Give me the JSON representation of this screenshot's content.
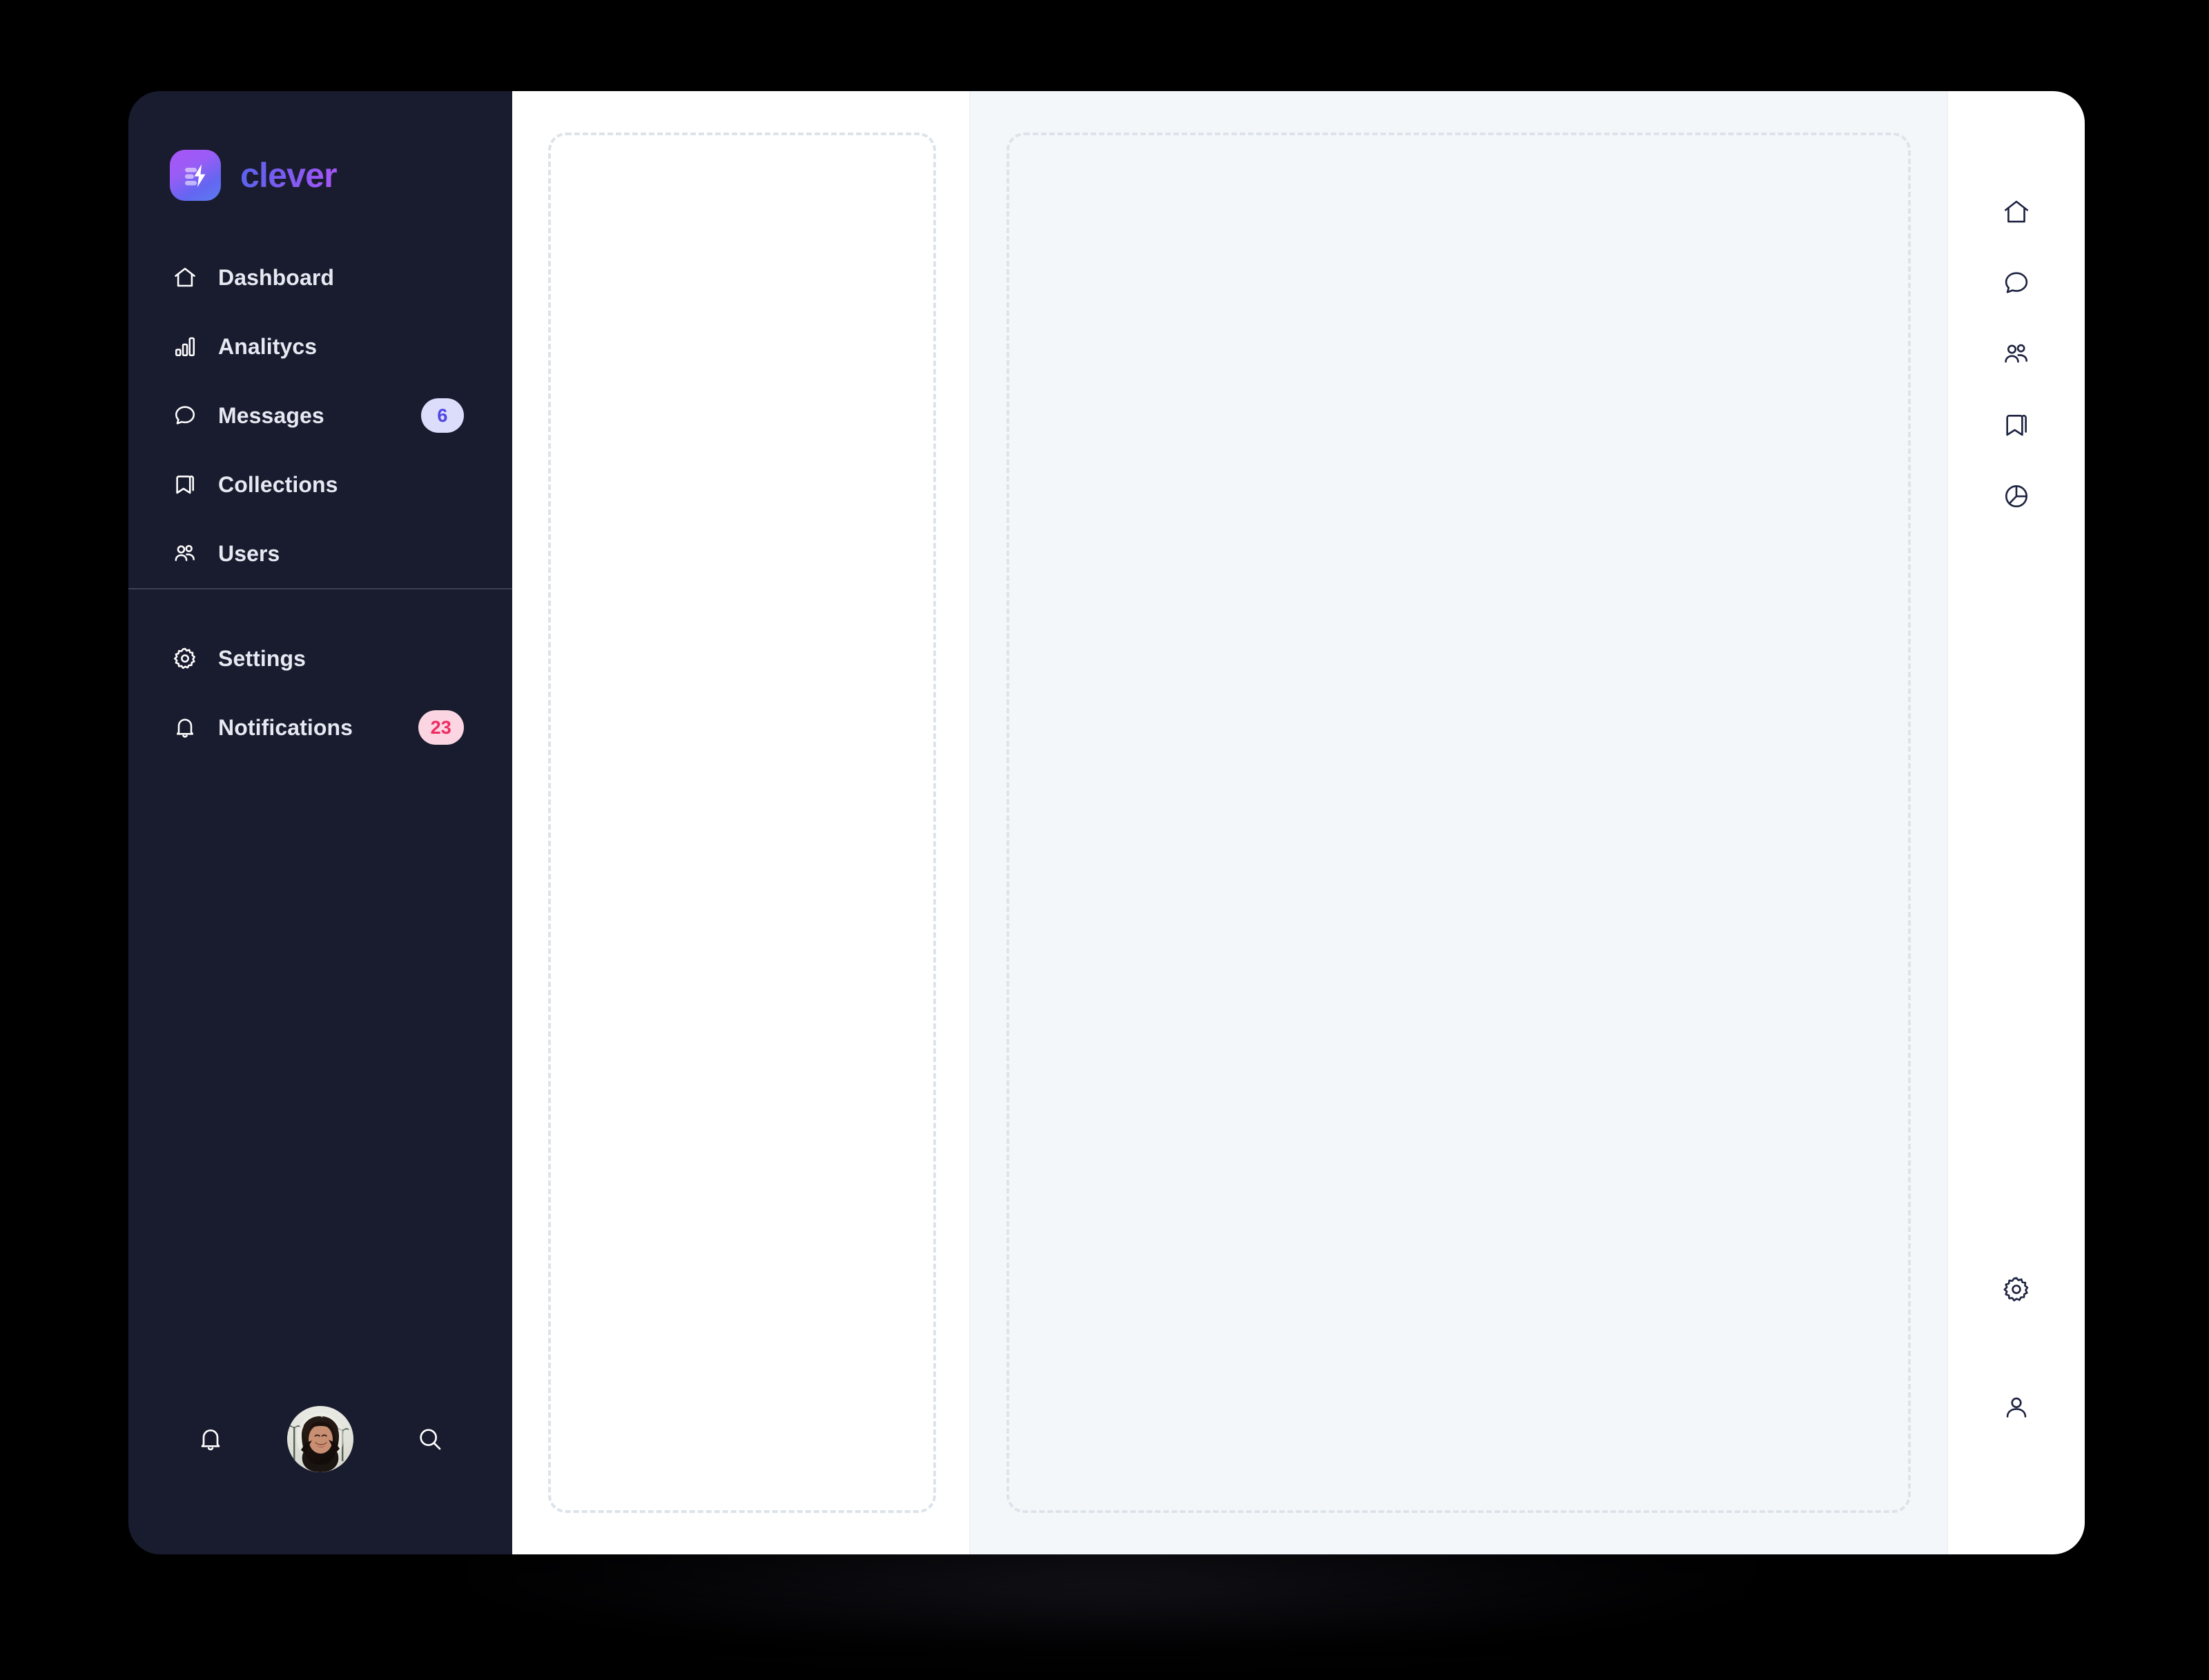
{
  "app": {
    "name": "clever",
    "logo_icon": "lightning-bolt-icon",
    "accent_start": "#5a63ec",
    "accent_end": "#a855f7",
    "sidebar_bg": "#191c2e",
    "content_bg": "#ffffff",
    "tint_bg": "#f4f7fa"
  },
  "sidebar": {
    "primary_items": [
      {
        "label": "Dashboard",
        "icon": "home-icon",
        "badge": null,
        "badge_style": null
      },
      {
        "label": "Analitycs",
        "icon": "bar-chart-icon",
        "badge": null,
        "badge_style": null
      },
      {
        "label": "Messages",
        "icon": "chat-bubble-icon",
        "badge": "6",
        "badge_style": "indigo"
      },
      {
        "label": "Collections",
        "icon": "bookmark-icon",
        "badge": null,
        "badge_style": null
      },
      {
        "label": "Users",
        "icon": "users-icon",
        "badge": null,
        "badge_style": null
      }
    ],
    "secondary_items": [
      {
        "label": "Settings",
        "icon": "gear-icon",
        "badge": null,
        "badge_style": null
      },
      {
        "label": "Notifications",
        "icon": "bell-icon",
        "badge": "23",
        "badge_style": "pink"
      }
    ],
    "footer": {
      "bell_icon": "bell-icon",
      "avatar_icon": "user-avatar-photo",
      "search_icon": "search-icon"
    },
    "badge_colors": {
      "indigo_bg": "#dcdcfb",
      "indigo_text": "#4f46e5",
      "pink_bg": "#fbd5e1",
      "pink_text": "#f02a63"
    }
  },
  "main": {
    "left_panel": {
      "placeholder": "empty-dashed-region"
    },
    "right_panel": {
      "placeholder": "empty-dashed-region"
    }
  },
  "rail": {
    "top_items": [
      {
        "icon": "home-icon"
      },
      {
        "icon": "chat-bubble-icon"
      },
      {
        "icon": "users-icon"
      },
      {
        "icon": "bookmark-icon"
      },
      {
        "icon": "pie-chart-icon"
      }
    ],
    "bottom_items": [
      {
        "icon": "gear-icon"
      },
      {
        "icon": "person-icon"
      }
    ]
  }
}
